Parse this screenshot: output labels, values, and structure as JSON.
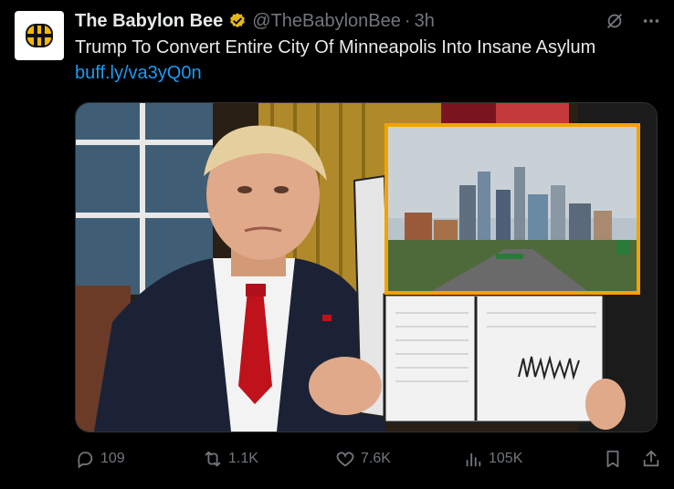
{
  "post": {
    "author_name": "The Babylon Bee",
    "handle": "@TheBabylonBee",
    "separator": "·",
    "time": "3h",
    "text": "Trump To Convert Entire City Of Minneapolis Into Insane Asylum",
    "link": "buff.ly/va3yQ0n"
  },
  "actions": {
    "replies": "109",
    "reposts": "1.1K",
    "likes": "7.6K",
    "views": "105K"
  },
  "icons": {
    "avatar": "bee-logo-icon",
    "verified": "verified-badge-icon",
    "grok": "grok-icon",
    "more": "more-icon",
    "reply": "reply-icon",
    "repost": "repost-icon",
    "like": "heart-icon",
    "views": "views-icon",
    "bookmark": "bookmark-icon",
    "share": "share-icon"
  },
  "colors": {
    "background": "#000000",
    "text": "#e7e9ea",
    "secondary": "#71767b",
    "link": "#1d9bf0",
    "verified_gold": "#e2b719"
  }
}
